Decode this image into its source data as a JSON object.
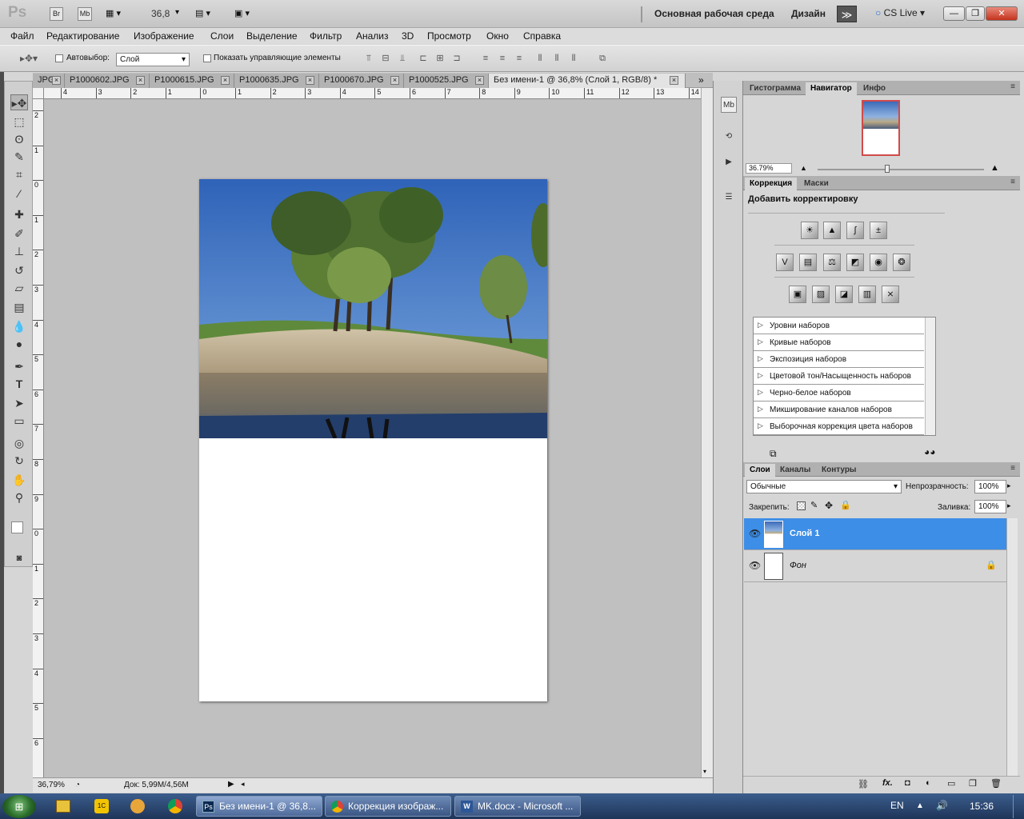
{
  "app": {
    "logo": "Ps",
    "zoom": "36,8",
    "workspace": "Основная рабочая среда",
    "design": "Дизайн",
    "cslive": "CS Live",
    "bridge": "Br",
    "minibridge": "Mb"
  },
  "window_controls": {
    "minimize": "—",
    "restore": "❐",
    "close": "✕"
  },
  "menu": [
    "Файл",
    "Редактирование",
    "Изображение",
    "Слои",
    "Выделение",
    "Фильтр",
    "Анализ",
    "3D",
    "Просмотр",
    "Окно",
    "Справка"
  ],
  "options": {
    "autoselect_label": "Автовыбор:",
    "autoselect_value": "Слой",
    "show_controls": "Показать управляющие элементы"
  },
  "tabs": [
    {
      "label": "JPG",
      "active": false
    },
    {
      "label": "P1000602.JPG",
      "active": false
    },
    {
      "label": "P1000615.JPG",
      "active": false
    },
    {
      "label": "P1000635.JPG",
      "active": false
    },
    {
      "label": "P1000670.JPG",
      "active": false
    },
    {
      "label": "P1000525.JPG",
      "active": false
    },
    {
      "label": "Без имени-1 @ 36,8% (Слой 1, RGB/8) *",
      "active": true
    }
  ],
  "tabs_overflow": "»",
  "ruler_h": [
    "4",
    "3",
    "2",
    "1",
    "0",
    "1",
    "2",
    "3",
    "4",
    "5",
    "6",
    "7",
    "8",
    "9",
    "10",
    "11",
    "12",
    "13",
    "14"
  ],
  "ruler_v": [
    "2",
    "1",
    "0",
    "1",
    "2",
    "3",
    "4",
    "5",
    "6",
    "7",
    "8",
    "9",
    "0",
    "1",
    "2",
    "3",
    "4",
    "5",
    "6"
  ],
  "status": {
    "zoom": "36,79%",
    "doc": "Док: 5,99M/4,56M"
  },
  "navigator": {
    "tabs": [
      "Гистограмма",
      "Навигатор",
      "Инфо"
    ],
    "active": 1,
    "zoom": "36.79%"
  },
  "adjustments": {
    "tabs": [
      "Коррекция",
      "Маски"
    ],
    "active": 0,
    "title": "Добавить корректировку",
    "presets": [
      "Уровни наборов",
      "Кривые наборов",
      "Экспозиция наборов",
      "Цветовой тон/Насыщенность наборов",
      "Черно-белое наборов",
      "Микширование каналов наборов",
      "Выборочная коррекция цвета наборов"
    ]
  },
  "layers": {
    "tabs": [
      "Слои",
      "Каналы",
      "Контуры"
    ],
    "active": 0,
    "blend_mode": "Обычные",
    "opacity_label": "Непрозрачность:",
    "opacity": "100%",
    "lock_label": "Закрепить:",
    "fill_label": "Заливка:",
    "fill": "100%",
    "items": [
      {
        "name": "Слой 1",
        "selected": true
      },
      {
        "name": "Фон",
        "selected": false,
        "locked": true
      }
    ]
  },
  "taskbar": {
    "items": [
      "Без имени-1 @ 36,8...",
      "Коррекция изображ...",
      "MK.docx - Microsoft ..."
    ],
    "lang": "EN",
    "time": "15:36"
  }
}
